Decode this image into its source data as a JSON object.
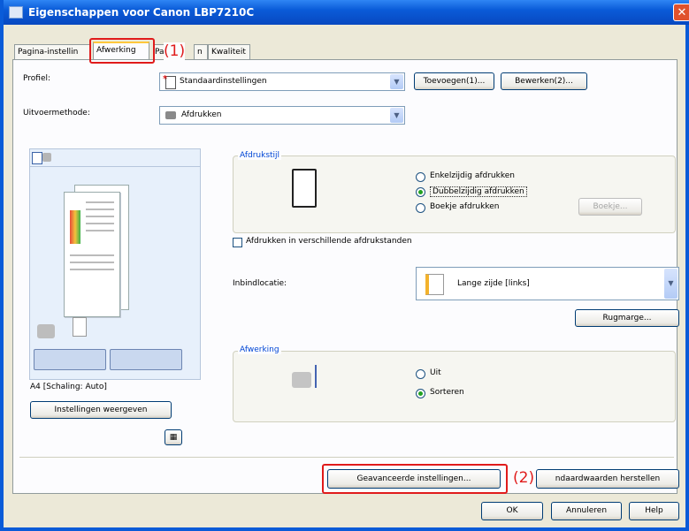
{
  "window": {
    "title": "Eigenschappen voor Canon LBP7210C"
  },
  "tabs": [
    "Pagina-instellin",
    "Afwerking",
    "Pa",
    "n",
    "Kwaliteit"
  ],
  "callouts": {
    "one": "(1)",
    "two": "(2)"
  },
  "profile": {
    "label": "Profiel:",
    "value": "Standaardinstellingen",
    "add_button": "Toevoegen(1)...",
    "edit_button": "Bewerken(2)..."
  },
  "output": {
    "label": "Uitvoermethode:",
    "value": "Afdrukken"
  },
  "preview": {
    "caption": "A4 [Schaling: Auto]",
    "show_settings_button": "Instellingen weergeven"
  },
  "print_style": {
    "title": "Afdrukstijl",
    "options": [
      "Enkelzijdig afdrukken",
      "Dubbelzijdig afdrukken",
      "Boekje afdrukken"
    ],
    "selected": "Dubbelzijdig afdrukken",
    "booklet_button": "Boekje..."
  },
  "mixed_checkbox": {
    "label": "Afdrukken in verschillende afdrukstanden",
    "checked": false
  },
  "binding": {
    "label": "Inbindlocatie:",
    "value": "Lange zijde [links]",
    "gutter_button": "Rugmarge..."
  },
  "finishing": {
    "title": "Afwerking",
    "options": [
      "Uit",
      "Sorteren"
    ],
    "selected": "Sorteren"
  },
  "footer": {
    "advanced_button": "Geavanceerde instellingen...",
    "restore_button": "ndaardwaarden herstellen"
  },
  "dialog": {
    "ok": "OK",
    "cancel": "Annuleren",
    "help": "Help"
  }
}
